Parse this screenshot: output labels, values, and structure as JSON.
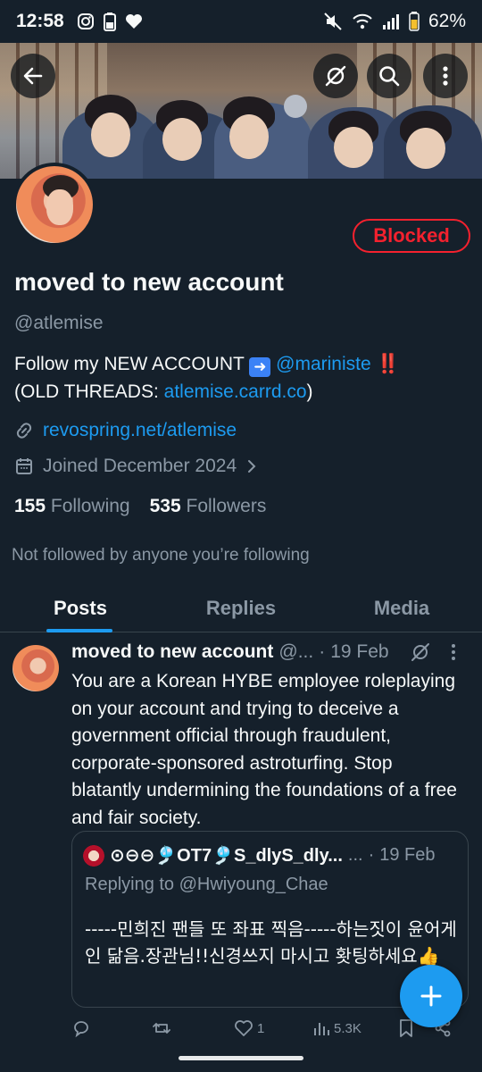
{
  "status_bar": {
    "time": "12:58",
    "battery": "62%"
  },
  "header": {
    "buttons": [
      "back-arrow-icon",
      "grok-icon",
      "search-icon",
      "more-icon"
    ]
  },
  "profile": {
    "name": "moved to new account",
    "handle": "@atlemise",
    "blocked_label": "Blocked",
    "bio_line1_prefix": "Follow my NEW ACCOUNT",
    "bio_line1_link": "@mariniste",
    "bio_line1_suffix": "‼️",
    "bio_line2_prefix": "(OLD THREADS: ",
    "bio_line2_link": "atlemise.carrd.co",
    "bio_line2_suffix": ")",
    "website": "revospring.net/atlemise",
    "joined": "Joined December 2024",
    "following_count": "155",
    "following_label": "Following",
    "followers_count": "535",
    "followers_label": "Followers",
    "not_followed": "Not followed by anyone you’re following"
  },
  "tabs": [
    {
      "label": "Posts",
      "active": true
    },
    {
      "label": "Replies",
      "active": false
    },
    {
      "label": "Media",
      "active": false
    }
  ],
  "post": {
    "author": "moved to new account",
    "handle_trunc": "@...",
    "dot": "·",
    "date": "19 Feb",
    "text": "You are a Korean HYBE employee roleplaying on your account and trying to deceive a government official through fraudulent, corporate-sponsored astroturfing. Stop blatantly undermining the foundations of a free and fair society.",
    "quote": {
      "author": "⊙⊖⊖🎐OT7🎐S_dlyS_dly...",
      "ellipsis": "...",
      "dot": "·",
      "date": "19 Feb",
      "replying_to": "Replying to @Hwiyoung_Chae",
      "text": "-----민희진 팬들 또 좌표 찍음-----하는짓이 윤어게인 닮음.장관님!!신경쓰지 마시고 홧팅하세요👍"
    },
    "likes": "1",
    "views": "5.3K"
  },
  "colors": {
    "background": "#15202b",
    "accent": "#1d9bf0",
    "blocked": "#f4212e",
    "muted": "#8b98a5"
  }
}
